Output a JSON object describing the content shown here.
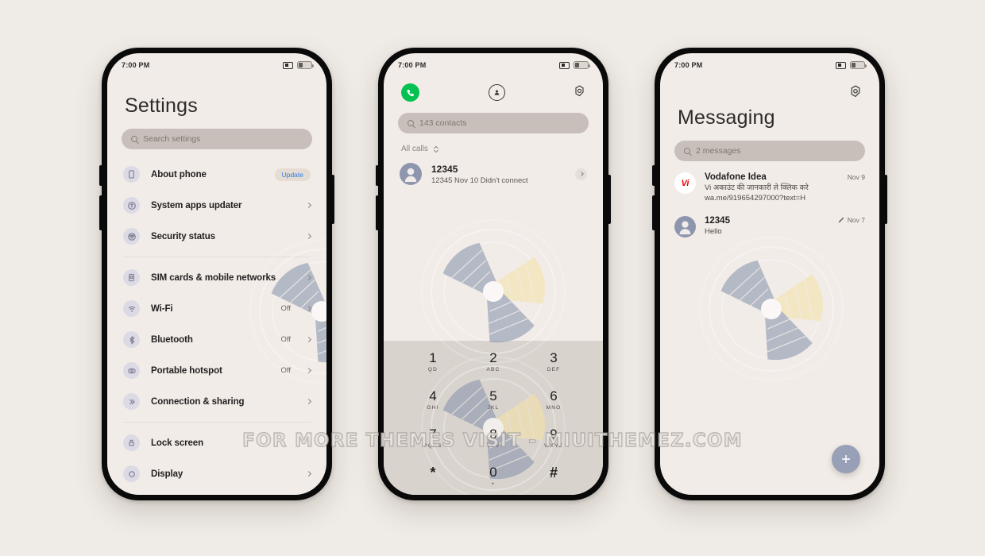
{
  "watermark": {
    "text": "FOR MORE THEMES VISIT - MIUITHEMEZ.COM"
  },
  "theme": {
    "background": "#efebe6",
    "screen_background": "#f2ece8",
    "accent_blue": "#2f7de0",
    "call_green": "#05c152",
    "fan_blue": "#8592ad",
    "fan_yellow": "#f2dfa6",
    "keypad_background": "#d9d3cd"
  },
  "status_bar": {
    "time": "7:00 PM",
    "mute_icon": "mute-icon",
    "battery_icon": "battery-icon"
  },
  "settings": {
    "title": "Settings",
    "search_placeholder": "Search settings",
    "search_icon": "search-icon",
    "group1": [
      {
        "icon": "phone-outline-icon",
        "label": "About phone",
        "value": "",
        "badge": "Update",
        "chevron": false
      },
      {
        "icon": "update-arrow-icon",
        "label": "System apps updater",
        "value": "",
        "badge": "",
        "chevron": true
      },
      {
        "icon": "security-shield-icon",
        "label": "Security status",
        "value": "",
        "badge": "",
        "chevron": true
      }
    ],
    "group2": [
      {
        "icon": "sim-card-icon",
        "label": "SIM cards & mobile networks",
        "value": "",
        "badge": "",
        "chevron": true
      },
      {
        "icon": "wifi-icon",
        "label": "Wi-Fi",
        "value": "Off",
        "badge": "",
        "chevron": true
      },
      {
        "icon": "bluetooth-icon",
        "label": "Bluetooth",
        "value": "Off",
        "badge": "",
        "chevron": true
      },
      {
        "icon": "hotspot-icon",
        "label": "Portable hotspot",
        "value": "Off",
        "badge": "",
        "chevron": true
      },
      {
        "icon": "connection-sharing-icon",
        "label": "Connection & sharing",
        "value": "",
        "badge": "",
        "chevron": true
      }
    ],
    "group3": [
      {
        "icon": "lock-icon",
        "label": "Lock screen",
        "value": "",
        "badge": "",
        "chevron": true
      },
      {
        "icon": "display-icon",
        "label": "Display",
        "value": "",
        "badge": "",
        "chevron": true
      }
    ]
  },
  "dialer": {
    "tabs": [
      {
        "name": "tab-keypad",
        "icon": "phone-handset-icon",
        "active": true
      },
      {
        "name": "tab-contacts",
        "icon": "person-circle-icon",
        "active": false
      }
    ],
    "settings_icon": "gear-icon",
    "search_placeholder": "143 contacts",
    "filter_label": "All calls",
    "filter_icon": "sort-chevrons-icon",
    "call_log": [
      {
        "name": "12345",
        "detail": "12345  Nov 10  Didn't connect",
        "avatar": "person-avatar"
      }
    ],
    "keys": [
      {
        "digit": "1",
        "letters": "QD"
      },
      {
        "digit": "2",
        "letters": "ABC"
      },
      {
        "digit": "3",
        "letters": "DEF"
      },
      {
        "digit": "4",
        "letters": "GHI"
      },
      {
        "digit": "5",
        "letters": "JKL"
      },
      {
        "digit": "6",
        "letters": "MNO"
      },
      {
        "digit": "7",
        "letters": "PQRS"
      },
      {
        "digit": "8",
        "letters": "TUV"
      },
      {
        "digit": "9",
        "letters": "WXYZ"
      },
      {
        "digit": "*",
        "letters": ""
      },
      {
        "digit": "0",
        "letters": "+"
      },
      {
        "digit": "#",
        "letters": ""
      }
    ],
    "bottom_bar": [
      {
        "name": "menu-button",
        "icon": "hamburger-icon"
      },
      {
        "name": "call-button",
        "icon": "phone-handset-icon"
      },
      {
        "name": "keypad-toggle-button",
        "icon": "dialpad-icon"
      }
    ]
  },
  "messaging": {
    "title": "Messaging",
    "settings_icon": "gear-icon",
    "search_placeholder": "2 messages",
    "threads": [
      {
        "name": "Vodafone Idea",
        "preview": "Vi अकाउंट की जानकारी ले क्लिक करे wa.me/919654297000?text=H",
        "date": "Nov 9",
        "avatar_type": "vi-logo",
        "avatar_text": "Vi",
        "draft": false
      },
      {
        "name": "12345",
        "preview": "Hello",
        "date": "Nov 7",
        "avatar_type": "person",
        "avatar_text": "",
        "draft": true
      }
    ],
    "fab_icon": "plus-icon"
  }
}
